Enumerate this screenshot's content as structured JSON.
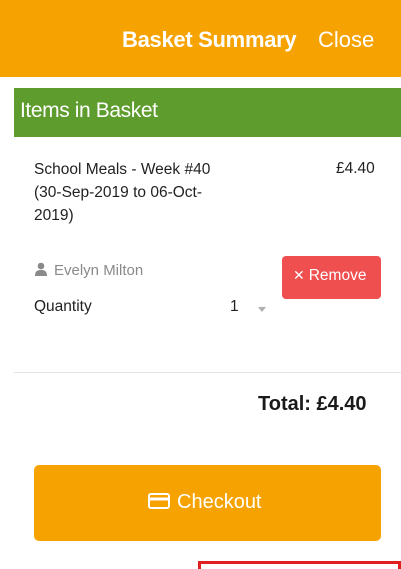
{
  "header": {
    "title": "Basket Summary",
    "close_label": "Close",
    "color": "#f6a200"
  },
  "section": {
    "title": "Items in Basket",
    "color": "#5f9c2e"
  },
  "basket": {
    "items": [
      {
        "name": "School Meals - Week #40 (30-Sep-2019 to 06-Oct-2019)",
        "price": "£4.40",
        "person": "Evelyn Milton",
        "person_icon": "user-icon",
        "remove_label": "Remove",
        "remove_icon": "close-icon",
        "quantity_label": "Quantity",
        "quantity_value": "1"
      }
    ],
    "total_label": "Total: £4.40"
  },
  "checkout": {
    "label": "Checkout",
    "icon": "credit-card-icon",
    "color": "#f6a200"
  },
  "colors": {
    "remove": "#f04f4f",
    "highlight": "#e02020"
  }
}
